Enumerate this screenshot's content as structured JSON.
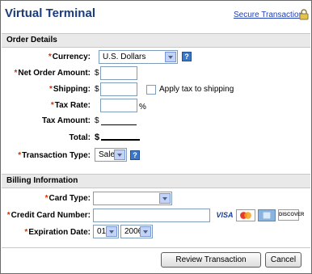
{
  "header": {
    "title": "Virtual Terminal",
    "secure_link": "Secure Transaction"
  },
  "order_details": {
    "section_title": "Order Details",
    "currency_label": "Currency:",
    "currency_value": "U.S. Dollars",
    "net_amount_label": "Net Order Amount:",
    "shipping_label": "Shipping:",
    "apply_tax_label": "Apply tax to shipping",
    "tax_rate_label": "Tax Rate:",
    "percent": "%",
    "tax_amount_label": "Tax Amount:",
    "total_label": "Total:",
    "transaction_type_label": "Transaction Type:",
    "transaction_type_value": "Sale",
    "dollar": "$",
    "required_mark": "*"
  },
  "billing": {
    "section_title": "Billing Information",
    "card_type_label": "Card Type:",
    "card_type_value": "",
    "card_number_label": "Credit Card Number:",
    "expiration_label": "Expiration Date:",
    "exp_month": "01",
    "exp_year": "2006",
    "card_logos": [
      "VISA",
      "MasterCard",
      "AMEX",
      "DISCOVER"
    ]
  },
  "footer": {
    "review_button": "Review Transaction",
    "cancel_button": "Cancel"
  }
}
